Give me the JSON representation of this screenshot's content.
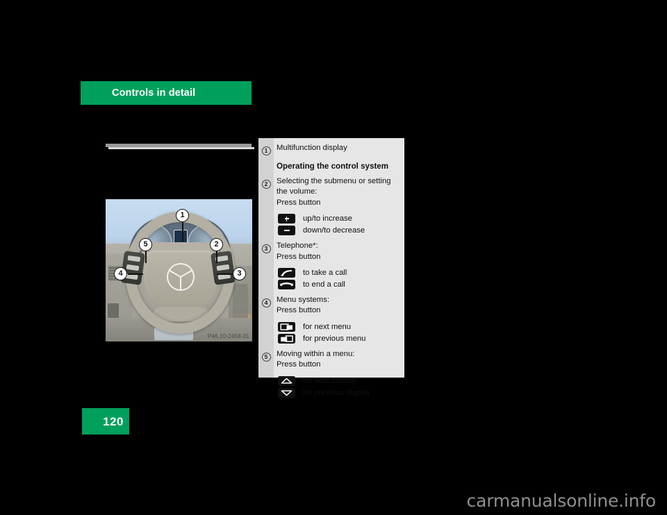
{
  "header": {
    "title": "Controls in detail",
    "accent_color": "#00a05c"
  },
  "figure": {
    "caption_code": "P46.10-2458-31",
    "callouts": [
      "1",
      "2",
      "3",
      "4",
      "5"
    ]
  },
  "legend": {
    "items": [
      {
        "number": "1",
        "text": "Multifunction display",
        "bold": false
      },
      {
        "number": "",
        "text": "Operating the control system",
        "bold": true
      },
      {
        "number": "2",
        "text": "Selecting the submenu or setting the volume:\nPress button",
        "bold": false
      },
      {
        "number": "3",
        "text": "Telephone*:\nPress button",
        "bold": false
      },
      {
        "number": "4",
        "text": "Menu systems:\nPress button",
        "bold": false
      },
      {
        "number": "5",
        "text": "Moving within a menu:\nPress button",
        "bold": false
      }
    ],
    "lines": {
      "l1": "Multifunction display",
      "l2": "Operating the control system",
      "l3a": "Selecting the submenu or setting",
      "l3b": "the volume:",
      "l3c": "Press button",
      "l4a": "Telephone*:",
      "l4b": "Press button",
      "l5a": "Menu systems:",
      "l5b": "Press button",
      "l6a": "Moving within a menu:",
      "l6b": "Press button"
    },
    "icons": {
      "plus": {
        "name": "plus-button-icon",
        "label": "up/to increase"
      },
      "minus": {
        "name": "minus-button-icon",
        "label": "down/to decrease"
      },
      "take_call": {
        "name": "take-call-icon",
        "label": "to take a call"
      },
      "end_call": {
        "name": "end-call-icon",
        "label": "to end a call"
      },
      "next_menu": {
        "name": "next-menu-icon",
        "label": "for next menu"
      },
      "prev_menu": {
        "name": "previous-menu-icon",
        "label": "for previous menu"
      },
      "next_display": {
        "name": "next-display-icon",
        "label": "for next display"
      },
      "prev_display": {
        "name": "previous-display-icon",
        "label": "for previous display"
      }
    }
  },
  "page": {
    "number": "120"
  },
  "watermark": {
    "text": "carmanualsonline.info"
  }
}
